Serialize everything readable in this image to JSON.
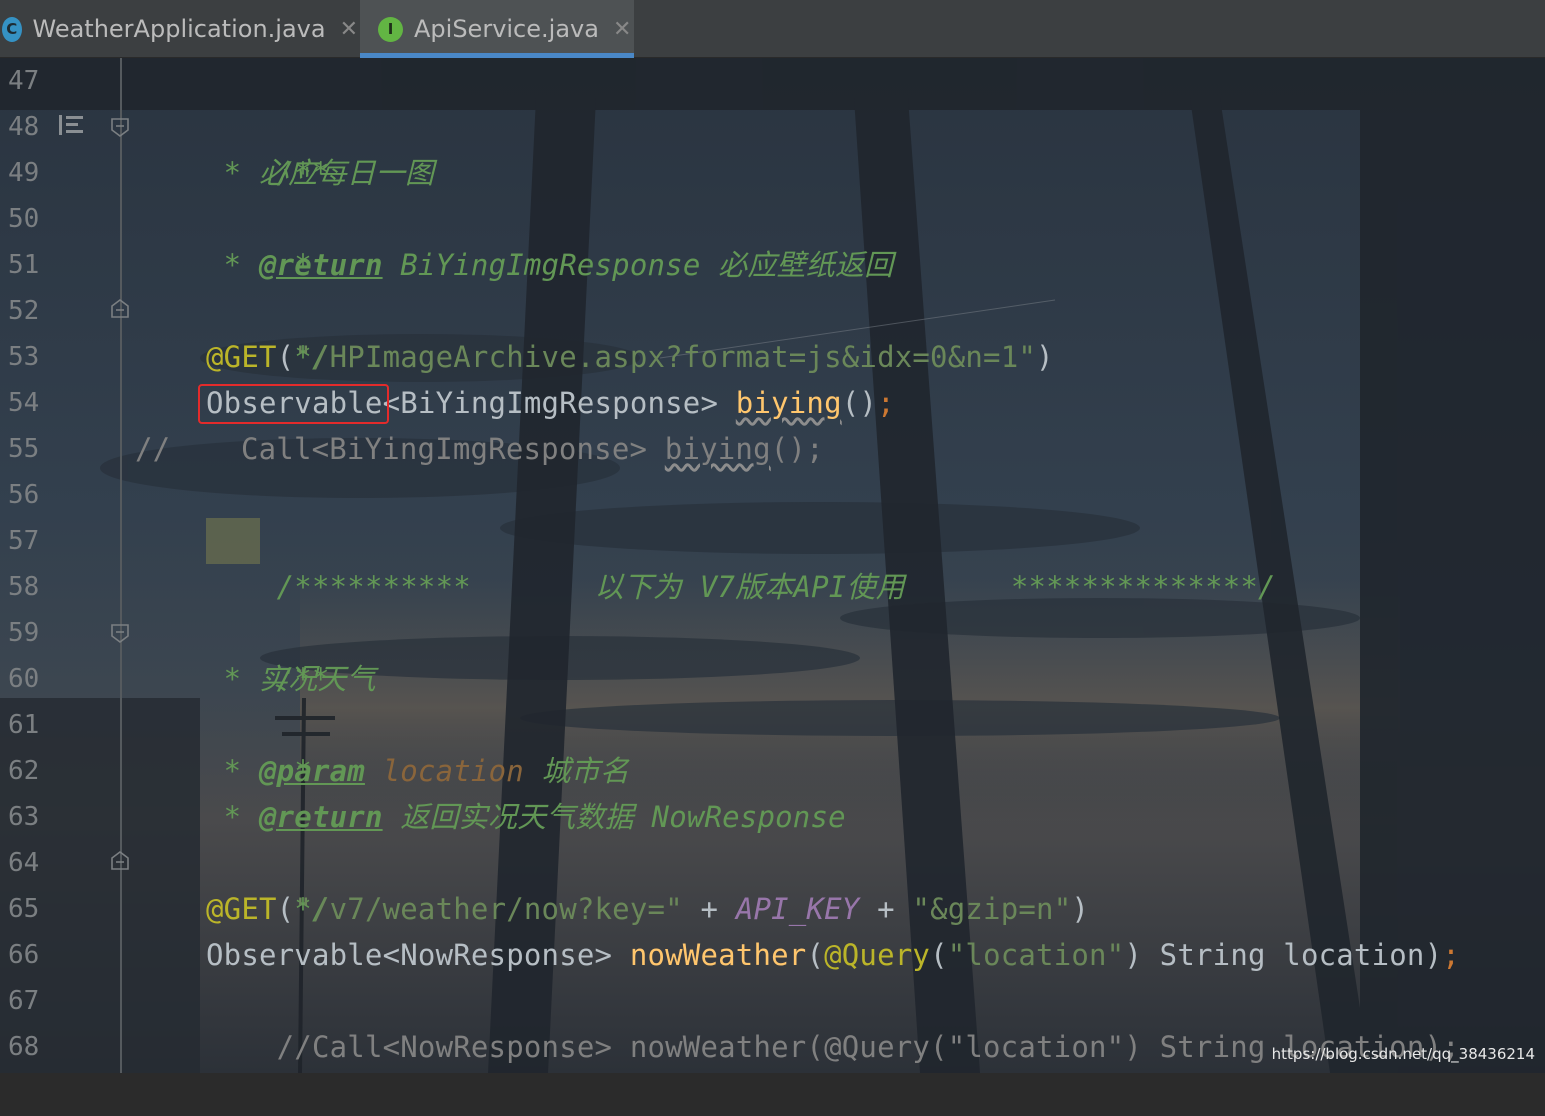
{
  "tabs": [
    {
      "label": "WeatherApplication.java",
      "icon": "class-icon",
      "icon_letter": "C",
      "active": false
    },
    {
      "label": "ApiService.java",
      "icon": "interface-icon",
      "icon_letter": "I",
      "active": true
    }
  ],
  "tab_close_glyph": "✕",
  "line_numbers": [
    "47",
    "48",
    "49",
    "50",
    "51",
    "52",
    "53",
    "54",
    "55",
    "56",
    "57",
    "58",
    "59",
    "60",
    "61",
    "62",
    "63",
    "64",
    "65",
    "66",
    "67",
    "68"
  ],
  "code": {
    "l48": "/**",
    "l49_star": " * ",
    "l49_text": "必应每日一图",
    "l50": " *",
    "l51_star": " * ",
    "l51_tag": "@return",
    "l51_text": " BiYingImgResponse 必应壁纸返回",
    "l52": " */",
    "l53_ann": "@GET",
    "l53_open": "(",
    "l53_str": "\"/HPImageArchive.aspx?format=js&idx=0&n=1\"",
    "l53_close": ")",
    "l54_type": "Observable<BiYingImgResponse> ",
    "l54_fn": "biying",
    "l54_paren": "()",
    "l54_semi": ";",
    "l55_slashes": "//",
    "l55_pre": "    Call<BiYingImgResponse> ",
    "l55_fn": "biying",
    "l55_post": "();",
    "l57": "/**********       以下为 V7版本API使用      **************/",
    "l59": "/**",
    "l60_star": " * ",
    "l60_text": "实况天气",
    "l61": " *",
    "l62_star": " * ",
    "l62_tag": "@param",
    "l62_name": " location",
    "l62_text": " 城市名",
    "l63_star": " * ",
    "l63_tag": "@return",
    "l63_text": " 返回实况天气数据 NowResponse",
    "l64": " */",
    "l65_ann": "@GET",
    "l65_open": "(",
    "l65_str1": "\"/v7/weather/now?key=\"",
    "l65_plus1": " + ",
    "l65_const": "API_KEY",
    "l65_plus2": " + ",
    "l65_str2": "\"&gzip=n\"",
    "l65_close": ")",
    "l66_type": "Observable<NowResponse> ",
    "l66_fn": "nowWeather",
    "l66_open": "(",
    "l66_ann": "@Query",
    "l66_arg_open": "(",
    "l66_str": "\"location\"",
    "l66_rest": ") String location)",
    "l66_semi": ";",
    "l67": "//Call<NowResponse> nowWeather(@Query(\"location\") String location);"
  },
  "watermark": "https://blog.csdn.net/qq_38436214",
  "colors": {
    "doc_comment": "#629755",
    "annotation": "#bbb529",
    "string": "#6a8759",
    "method": "#ffc66d",
    "keyword_punct": "#cc7832",
    "constant": "#9876aa",
    "line_comment": "#808080",
    "highlight_box": "#e32b2b",
    "tab_underline": "#4a88c7"
  }
}
